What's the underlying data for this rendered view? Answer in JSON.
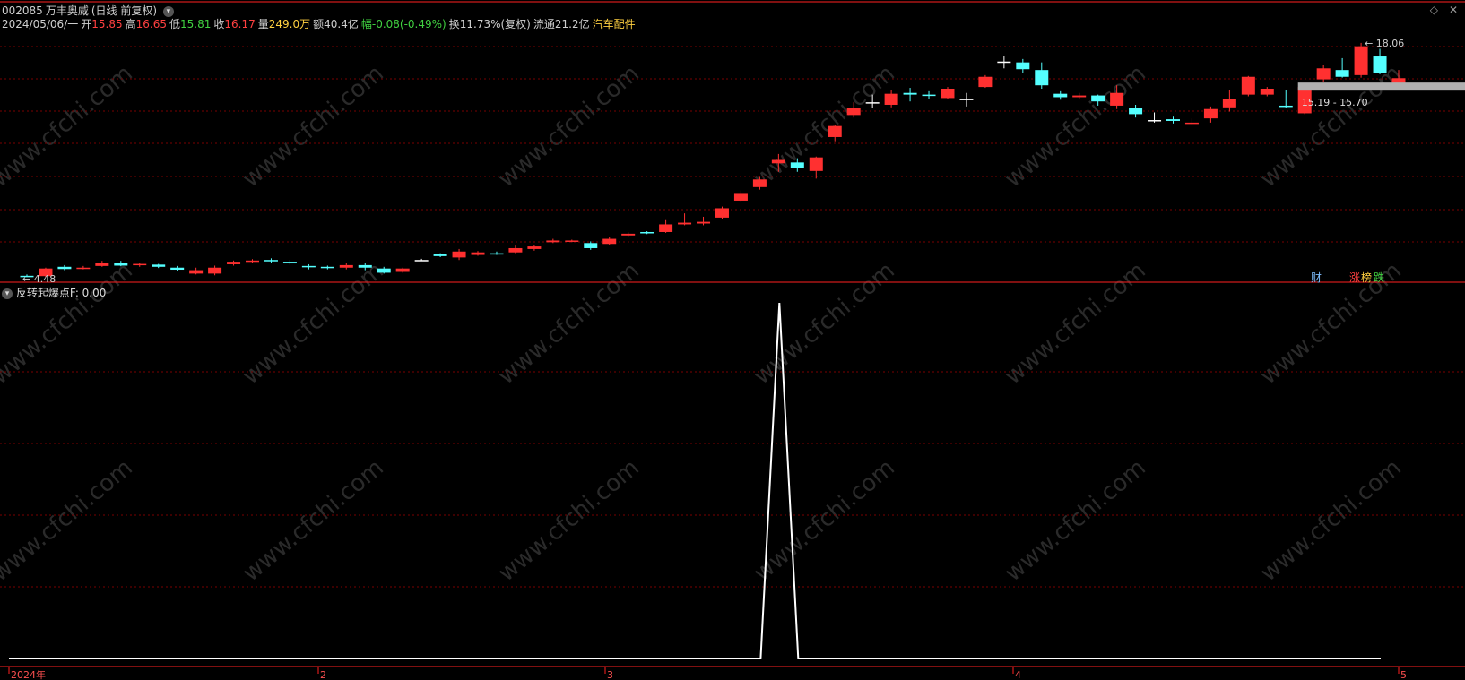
{
  "header": {
    "code": "002085",
    "name": "万丰奥威",
    "period": "(日线 前复权)",
    "date": "2024/05/06/一",
    "open_label": "开",
    "open": "15.85",
    "high_label": "高",
    "high": "16.65",
    "low_label": "低",
    "low": "15.81",
    "close_label": "收",
    "close": "16.17",
    "vol_label": "量",
    "vol": "249.0万",
    "amount_label": "额",
    "amount": "40.4亿",
    "change_label": "幅",
    "change": "-0.08(-0.49%)",
    "turnover": "换11.73%(复权)",
    "float_cap": "流通21.2亿",
    "sector": "汽车配件"
  },
  "indicator": {
    "name": "反转起爆点F",
    "value": ": 0.00"
  },
  "badges": {
    "cai": "财",
    "zhang": "涨",
    "bang": "榜",
    "die": "跌"
  },
  "watermark": "www.cfchi.com",
  "colors": {
    "up": "#ff3030",
    "down": "#54ffff",
    "grid": "#7a0000",
    "background": "#000000",
    "axis": "#ff2020",
    "indicator_line": "#ffffff"
  },
  "chart_data": [
    {
      "type": "candlestick",
      "title": "002085 万丰奥威 (日线 前复权)",
      "annotations": {
        "low_marker": "4.48",
        "high_marker": "18.06",
        "price_range": "15.19 - 15.70"
      },
      "ylim": [
        4.3,
        19.3
      ],
      "candles": [
        [
          4.52,
          4.48,
          4.6,
          4.45
        ],
        [
          4.5,
          4.95,
          5.0,
          4.45
        ],
        [
          5.05,
          4.92,
          5.15,
          4.85
        ],
        [
          4.95,
          5.0,
          5.1,
          4.9
        ],
        [
          5.1,
          5.3,
          5.4,
          5.05
        ],
        [
          5.3,
          5.12,
          5.4,
          5.08
        ],
        [
          5.15,
          5.22,
          5.28,
          5.05
        ],
        [
          5.18,
          5.05,
          5.22,
          4.98
        ],
        [
          5.0,
          4.88,
          5.1,
          4.8
        ],
        [
          4.65,
          4.85,
          5.0,
          4.6
        ],
        [
          4.65,
          5.0,
          5.12,
          4.55
        ],
        [
          5.2,
          5.35,
          5.42,
          5.12
        ],
        [
          5.35,
          5.42,
          5.5,
          5.3
        ],
        [
          5.45,
          5.38,
          5.55,
          5.3
        ],
        [
          5.35,
          5.25,
          5.45,
          5.18
        ],
        [
          5.1,
          5.05,
          5.2,
          4.9
        ],
        [
          5.05,
          5.0,
          5.12,
          4.9
        ],
        [
          5.0,
          5.15,
          5.25,
          4.9
        ],
        [
          5.15,
          5.0,
          5.3,
          4.85
        ],
        [
          4.95,
          4.7,
          5.05,
          4.65
        ],
        [
          4.75,
          4.95,
          5.0,
          4.7
        ],
        [
          5.45,
          5.45,
          5.52,
          5.4
        ],
        [
          5.8,
          5.68,
          5.85,
          5.62
        ],
        [
          5.6,
          5.95,
          6.1,
          5.45
        ],
        [
          5.75,
          5.9,
          5.98,
          5.7
        ],
        [
          5.85,
          5.8,
          5.95,
          5.75
        ],
        [
          5.9,
          6.15,
          6.3,
          5.85
        ],
        [
          6.1,
          6.25,
          6.35,
          6.0
        ],
        [
          6.5,
          6.6,
          6.7,
          6.45
        ],
        [
          6.55,
          6.6,
          6.65,
          6.5
        ],
        [
          6.45,
          6.15,
          6.55,
          6.05
        ],
        [
          6.4,
          6.7,
          6.8,
          6.35
        ],
        [
          6.9,
          7.0,
          7.08,
          6.85
        ],
        [
          7.1,
          7.02,
          7.15,
          6.98
        ],
        [
          7.1,
          7.55,
          7.8,
          7.05
        ],
        [
          7.55,
          7.65,
          8.2,
          7.5
        ],
        [
          7.6,
          7.7,
          8.0,
          7.5
        ],
        [
          7.95,
          8.5,
          8.6,
          7.85
        ],
        [
          8.95,
          9.4,
          9.55,
          8.85
        ],
        [
          9.75,
          10.2,
          10.35,
          9.6
        ],
        [
          11.15,
          11.35,
          11.7,
          10.65
        ],
        [
          11.2,
          10.85,
          11.45,
          10.65
        ],
        [
          10.7,
          11.5,
          11.55,
          10.25
        ],
        [
          12.7,
          13.35,
          13.4,
          12.45
        ],
        [
          14.0,
          14.4,
          14.75,
          13.85
        ],
        [
          14.75,
          14.75,
          15.2,
          14.4
        ],
        [
          14.6,
          15.25,
          15.45,
          14.45
        ],
        [
          15.3,
          15.2,
          15.6,
          14.8
        ],
        [
          15.2,
          15.15,
          15.4,
          14.95
        ],
        [
          15.0,
          15.55,
          15.65,
          14.95
        ],
        [
          14.95,
          14.95,
          15.3,
          14.5
        ],
        [
          15.65,
          16.25,
          16.35,
          15.6
        ],
        [
          17.15,
          17.15,
          17.5,
          16.75
        ],
        [
          17.1,
          16.7,
          17.3,
          16.45
        ],
        [
          16.65,
          15.75,
          17.1,
          15.55
        ],
        [
          15.25,
          15.05,
          15.4,
          14.9
        ],
        [
          15.05,
          15.15,
          15.3,
          14.95
        ],
        [
          15.15,
          14.8,
          15.2,
          14.55
        ],
        [
          14.55,
          15.3,
          15.75,
          14.35
        ],
        [
          14.4,
          14.05,
          14.6,
          13.85
        ],
        [
          13.7,
          13.7,
          14.15,
          13.55
        ],
        [
          13.75,
          13.65,
          13.9,
          13.5
        ],
        [
          13.5,
          13.55,
          13.8,
          13.4
        ],
        [
          13.8,
          14.35,
          14.5,
          13.55
        ],
        [
          14.45,
          14.95,
          15.45,
          14.2
        ],
        [
          15.2,
          16.25,
          16.3,
          15.1
        ],
        [
          15.2,
          15.55,
          15.65,
          15.1
        ],
        [
          14.55,
          14.5,
          15.45,
          14.4
        ],
        [
          14.1,
          15.65,
          15.75,
          14.05
        ],
        [
          16.1,
          16.75,
          16.95,
          15.95
        ],
        [
          16.65,
          16.25,
          17.35,
          16.2
        ],
        [
          16.35,
          18.05,
          18.25,
          16.2
        ],
        [
          17.45,
          16.5,
          17.9,
          16.4
        ],
        [
          15.85,
          16.17,
          16.65,
          15.81
        ]
      ],
      "xticks": [
        "2024年",
        "2",
        "3",
        "4",
        "5"
      ]
    },
    {
      "type": "line",
      "title": "反转起爆点F",
      "series": [
        {
          "name": "反转起爆点F",
          "values": [
            0,
            0,
            0,
            0,
            0,
            0,
            0,
            0,
            0,
            0,
            0,
            0,
            0,
            0,
            0,
            0,
            0,
            0,
            0,
            0,
            0,
            0,
            0,
            0,
            0,
            0,
            0,
            0,
            0,
            0,
            0,
            0,
            0,
            0,
            0,
            0,
            0,
            0,
            0,
            0,
            0,
            1,
            0,
            0,
            0,
            0,
            0,
            0,
            0,
            0,
            0,
            0,
            0,
            0,
            0,
            0,
            0,
            0,
            0,
            0,
            0,
            0,
            0,
            0,
            0,
            0,
            0,
            0,
            0,
            0,
            0,
            0,
            0,
            0
          ]
        }
      ],
      "ylim": [
        0,
        1
      ]
    }
  ]
}
